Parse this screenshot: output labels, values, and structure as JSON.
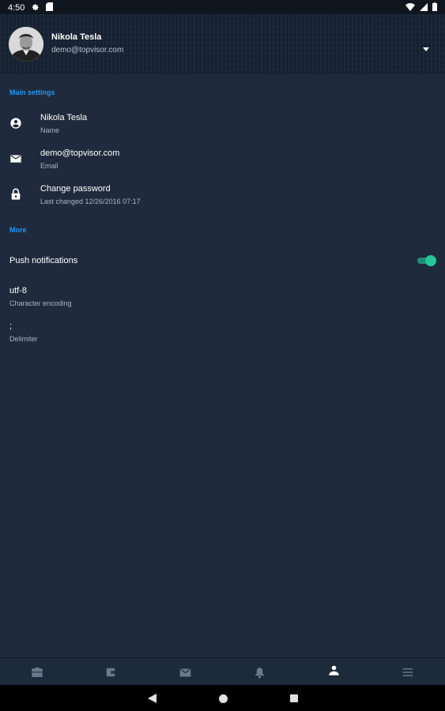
{
  "status_bar": {
    "time": "4:50",
    "left_icons": [
      "gear-icon",
      "sd-card-icon"
    ],
    "right_icons": [
      "wifi-icon",
      "signal-icon",
      "battery-icon"
    ]
  },
  "account": {
    "name": "Nikola Tesla",
    "email": "demo@topvisor.com"
  },
  "sections": {
    "main": "Main settings",
    "more": "More"
  },
  "main_settings": {
    "name_value": "Nikola Tesla",
    "name_label": "Name",
    "email_value": "demo@topvisor.com",
    "email_label": "Email",
    "password_value": "Change password",
    "password_label": "Last changed 12/26/2016 07:17"
  },
  "more_settings": {
    "push_label": "Push notifications",
    "push_enabled": true,
    "encoding_value": "utf-8",
    "encoding_label": "Character encoding",
    "delimiter_value": ";",
    "delimiter_label": "Delimiter"
  },
  "bottom_nav": {
    "items": [
      "briefcase-icon",
      "wallet-icon",
      "mail-icon",
      "bell-icon",
      "person-icon",
      "menu-icon"
    ],
    "active": "person-icon"
  },
  "colors": {
    "background": "#1f2b3c",
    "accent": "#2196f3",
    "toggle_on": "#26c69a"
  }
}
